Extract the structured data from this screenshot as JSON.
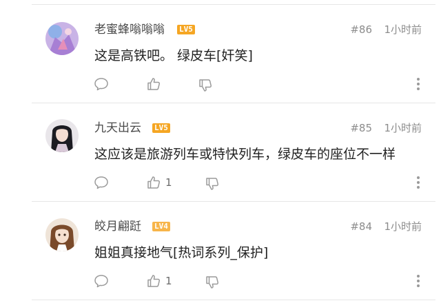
{
  "comments": [
    {
      "username": "老蜜蜂嗡嗡嗡",
      "level": "LV5",
      "level_color": "#f5a623",
      "floor": "#86",
      "time": "1小时前",
      "content": "这是高铁吧。 绿皮车[奸笑]",
      "like_count": "",
      "avatar_icon": "anime-avatar-purple"
    },
    {
      "username": "九天出云",
      "level": "LV5",
      "level_color": "#f5a623",
      "floor": "#85",
      "time": "1小时前",
      "content": "这应该是旅游列车或特快列车，绿皮车的座位不一样",
      "like_count": "1",
      "avatar_icon": "anime-avatar-dark-hair"
    },
    {
      "username": "皎月翩跹",
      "level": "LV4",
      "level_color": "#f7b54a",
      "floor": "#84",
      "time": "1小时前",
      "content": "姐姐真接地气[热词系列_保护]",
      "like_count": "1",
      "avatar_icon": "anime-avatar-brown-hair"
    }
  ]
}
